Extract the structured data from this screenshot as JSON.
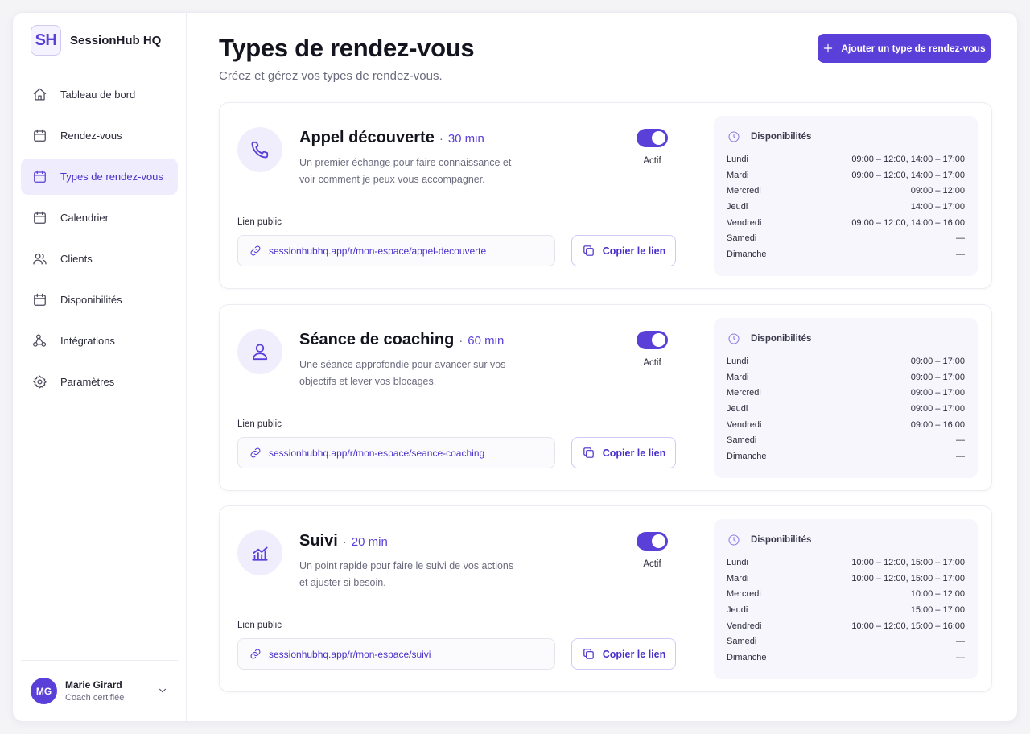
{
  "brand": {
    "logo": "SH",
    "name": "SessionHub HQ"
  },
  "nav": [
    {
      "label": "Tableau de bord",
      "icon": "home-icon"
    },
    {
      "label": "Rendez-vous",
      "icon": "calendar-icon"
    },
    {
      "label": "Types de rendez-vous",
      "icon": "calendar-icon",
      "active": true
    },
    {
      "label": "Calendrier",
      "icon": "calendar-icon"
    },
    {
      "label": "Clients",
      "icon": "users-icon"
    },
    {
      "label": "Disponibilités",
      "icon": "calendar-icon"
    },
    {
      "label": "Intégrations",
      "icon": "integrations-icon"
    },
    {
      "label": "Paramètres",
      "icon": "gear-icon"
    }
  ],
  "user": {
    "initials": "MG",
    "name": "Marie Girard",
    "role": "Coach certifiée"
  },
  "header": {
    "title": "Types de rendez-vous",
    "subtitle": "Créez et gérez vos types de rendez-vous.",
    "add_button": "Ajouter un type de rendez-vous"
  },
  "labels": {
    "status": "Actif",
    "public_link": "Lien public",
    "copy_link": "Copier le lien",
    "availability": "Disponibilités",
    "separator": "·"
  },
  "colors": {
    "accent": "#5b3fd9",
    "accent_soft": "#efecfe"
  },
  "types": [
    {
      "name": "Appel découverte",
      "duration": "30 min",
      "icon": "phone-icon",
      "description": "Un premier échange pour faire connaissance et voir comment je peux vous accompagner.",
      "active": true,
      "url": "sessionhubhq.app/r/mon-espace/appel-decouverte",
      "availability": [
        {
          "day": "Lundi",
          "hours": "09:00 – 12:00, 14:00 – 17:00"
        },
        {
          "day": "Mardi",
          "hours": "09:00 – 12:00, 14:00 – 17:00"
        },
        {
          "day": "Mercredi",
          "hours": "09:00 – 12:00"
        },
        {
          "day": "Jeudi",
          "hours": "14:00 – 17:00"
        },
        {
          "day": "Vendredi",
          "hours": "09:00 – 12:00, 14:00 – 16:00"
        },
        {
          "day": "Samedi",
          "hours": "—"
        },
        {
          "day": "Dimanche",
          "hours": "—"
        }
      ]
    },
    {
      "name": "Séance de coaching",
      "duration": "60 min",
      "icon": "user-icon",
      "description": "Une séance approfondie pour avancer sur vos objectifs et lever vos blocages.",
      "active": true,
      "url": "sessionhubhq.app/r/mon-espace/seance-coaching",
      "availability": [
        {
          "day": "Lundi",
          "hours": "09:00 – 17:00"
        },
        {
          "day": "Mardi",
          "hours": "09:00 – 17:00"
        },
        {
          "day": "Mercredi",
          "hours": "09:00 – 17:00"
        },
        {
          "day": "Jeudi",
          "hours": "09:00 – 17:00"
        },
        {
          "day": "Vendredi",
          "hours": "09:00 – 16:00"
        },
        {
          "day": "Samedi",
          "hours": "—"
        },
        {
          "day": "Dimanche",
          "hours": "—"
        }
      ]
    },
    {
      "name": "Suivi",
      "duration": "20 min",
      "icon": "chart-icon",
      "description": "Un point rapide pour faire le suivi de vos actions et ajuster si besoin.",
      "active": true,
      "url": "sessionhubhq.app/r/mon-espace/suivi",
      "availability": [
        {
          "day": "Lundi",
          "hours": "10:00 – 12:00, 15:00 – 17:00"
        },
        {
          "day": "Mardi",
          "hours": "10:00 – 12:00, 15:00 – 17:00"
        },
        {
          "day": "Mercredi",
          "hours": "10:00 – 12:00"
        },
        {
          "day": "Jeudi",
          "hours": "15:00 – 17:00"
        },
        {
          "day": "Vendredi",
          "hours": "10:00 – 12:00, 15:00 – 16:00"
        },
        {
          "day": "Samedi",
          "hours": "—"
        },
        {
          "day": "Dimanche",
          "hours": "—"
        }
      ]
    }
  ]
}
